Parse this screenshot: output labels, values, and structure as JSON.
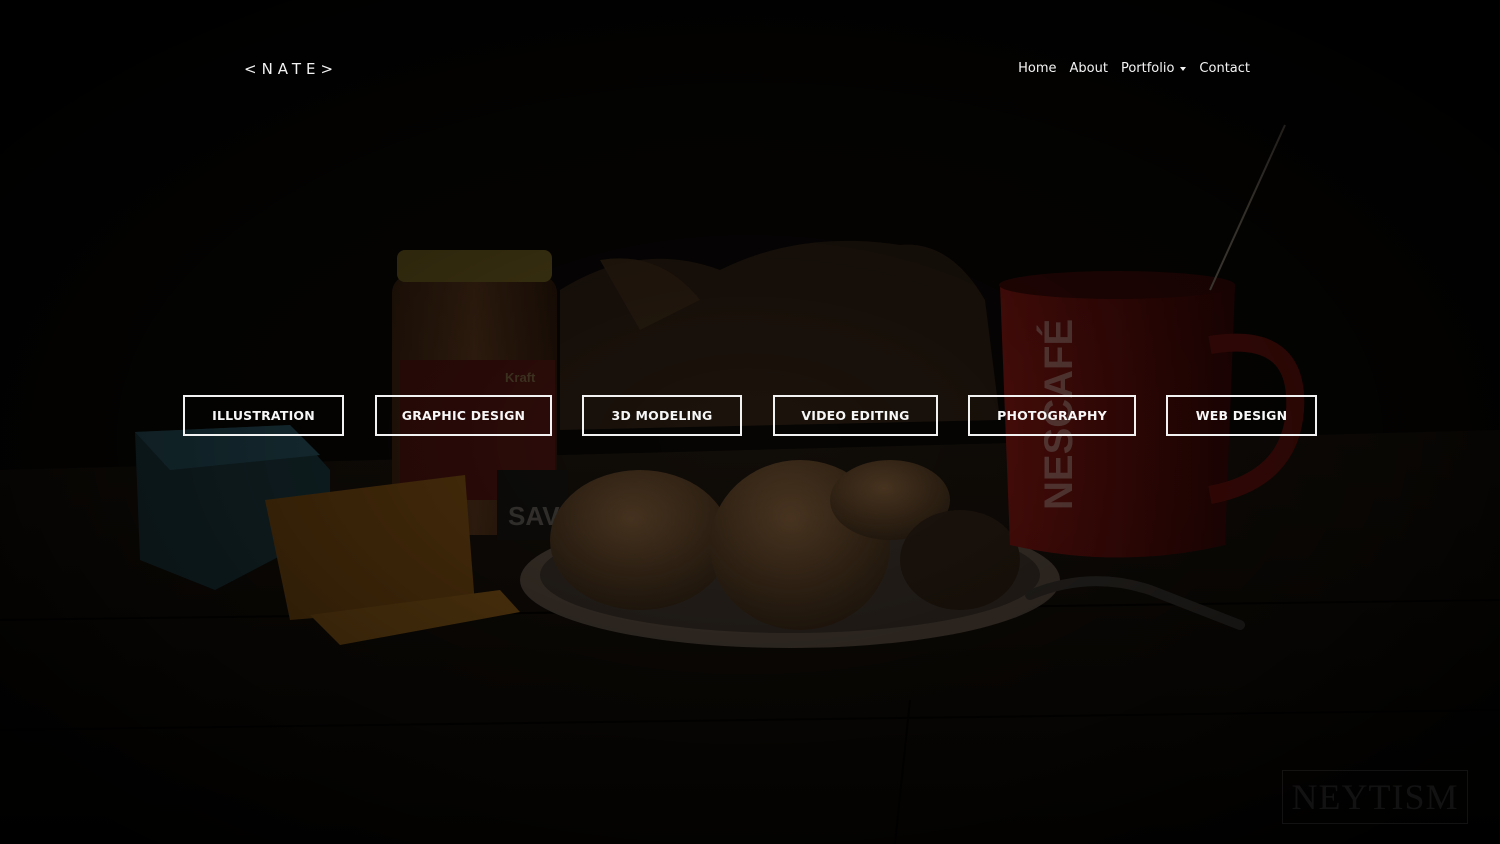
{
  "header": {
    "logo": "<NATE>",
    "nav": [
      "Home",
      "About",
      "Portfolio",
      "Contact"
    ]
  },
  "categories": [
    "ILLUSTRATION",
    "GRAPHIC DESIGN",
    "3D MODELING",
    "VIDEO EDITING",
    "PHOTOGRAPHY",
    "WEB DESIGN"
  ],
  "watermark": "NEYTISM",
  "colors": {
    "background": "#0b0906",
    "text": "#f2f2f2",
    "mug_red": "#7a1410"
  }
}
